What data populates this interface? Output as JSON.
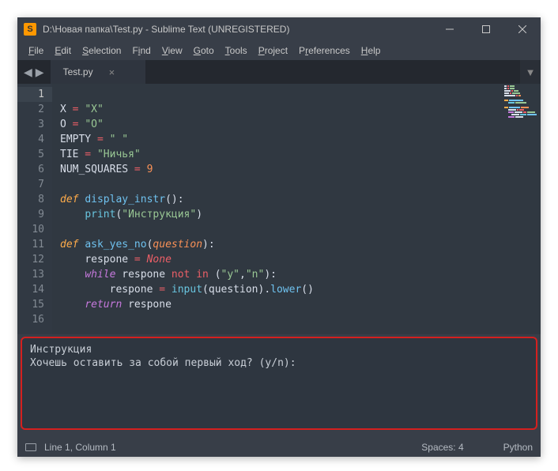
{
  "titlebar": {
    "icon": "S",
    "title": "D:\\Новая папка\\Test.py - Sublime Text (UNREGISTERED)"
  },
  "menu": {
    "file": "File",
    "edit": "Edit",
    "selection": "Selection",
    "find": "Find",
    "view": "View",
    "goto": "Goto",
    "tools": "Tools",
    "project": "Project",
    "preferences": "Preferences",
    "help": "Help"
  },
  "tab": {
    "name": "Test.py",
    "close": "×"
  },
  "nav": {
    "back": "◀",
    "fwd": "▶",
    "dropdown": "▼"
  },
  "gutter": {
    "lines": [
      "1",
      "2",
      "3",
      "4",
      "5",
      "6",
      "7",
      "8",
      "9",
      "10",
      "11",
      "12",
      "13",
      "14",
      "15",
      "16"
    ],
    "active": 1
  },
  "code": {
    "l2_var": "X",
    "l2_eq": " = ",
    "l2_val": "\"X\"",
    "l3_var": "O",
    "l3_eq": " = ",
    "l3_val": "\"O\"",
    "l4_var": "EMPTY",
    "l4_eq": " = ",
    "l4_val": "\" \"",
    "l5_var": "TIE",
    "l5_eq": " = ",
    "l5_val": "\"Ничья\"",
    "l6_var": "NUM_SQUARES",
    "l6_eq": " = ",
    "l6_val": "9",
    "l8_def": "def ",
    "l8_fn": "display_instr",
    "l8_paren": "():",
    "l9_ind": "    ",
    "l9_print": "print",
    "l9_open": "(",
    "l9_str": "\"Инструкция\"",
    "l9_close": ")",
    "l11_def": "def ",
    "l11_fn": "ask_yes_no",
    "l11_open": "(",
    "l11_param": "question",
    "l11_close": "):",
    "l12_ind": "    ",
    "l12_var": "respone",
    "l12_eq": " = ",
    "l12_none": "None",
    "l13_ind": "    ",
    "l13_while": "while",
    "l13_sp": " ",
    "l13_var": "respone",
    "l13_sp2": " ",
    "l13_not": "not",
    "l13_sp3": " ",
    "l13_in": "in",
    "l13_sp4": " ",
    "l13_open": "(",
    "l13_y": "\"y\"",
    "l13_comma": ",",
    "l13_n": "\"n\"",
    "l13_close": "):",
    "l14_ind": "        ",
    "l14_var": "respone",
    "l14_eq": " = ",
    "l14_input": "input",
    "l14_open": "(",
    "l14_arg": "question",
    "l14_close": ")",
    "l14_dot": ".",
    "l14_lower": "lower",
    "l14_call": "()",
    "l15_ind": "    ",
    "l15_ret": "return",
    "l15_sp": " ",
    "l15_var": "respone"
  },
  "console": {
    "line1": "Инструкция",
    "line2": "Хочешь оставить за собой первый ход? (y/n):"
  },
  "status": {
    "pos": "Line 1, Column 1",
    "spaces": "Spaces: 4",
    "lang": "Python"
  }
}
